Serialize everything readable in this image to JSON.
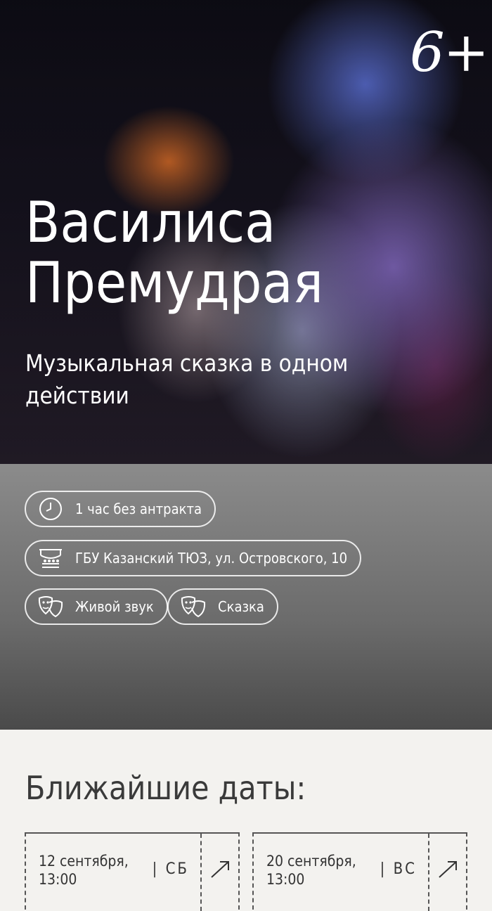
{
  "hero": {
    "age_rating": "6+",
    "title_line1": "Василиса",
    "title_line2": "Премудрая",
    "subtitle": "Музыкальная сказка в одном действии"
  },
  "info": {
    "duration": {
      "label": "1 час без антракта",
      "icon": "clock-icon"
    },
    "venue": {
      "label": "ГБУ Казанский ТЮЗ, ул. Островского, 10",
      "icon": "theater-building-icon"
    },
    "tags": [
      {
        "label": "Живой звук",
        "icon": "theater-masks-icon"
      },
      {
        "label": "Сказка",
        "icon": "theater-masks-icon"
      }
    ]
  },
  "dates": {
    "heading": "Ближайшие даты:",
    "items": [
      {
        "date": "12 сентября,",
        "time": "13:00",
        "dow": "| СБ"
      },
      {
        "date": "20 сентября,",
        "time": "13:00",
        "dow": "| ВС"
      }
    ]
  }
}
